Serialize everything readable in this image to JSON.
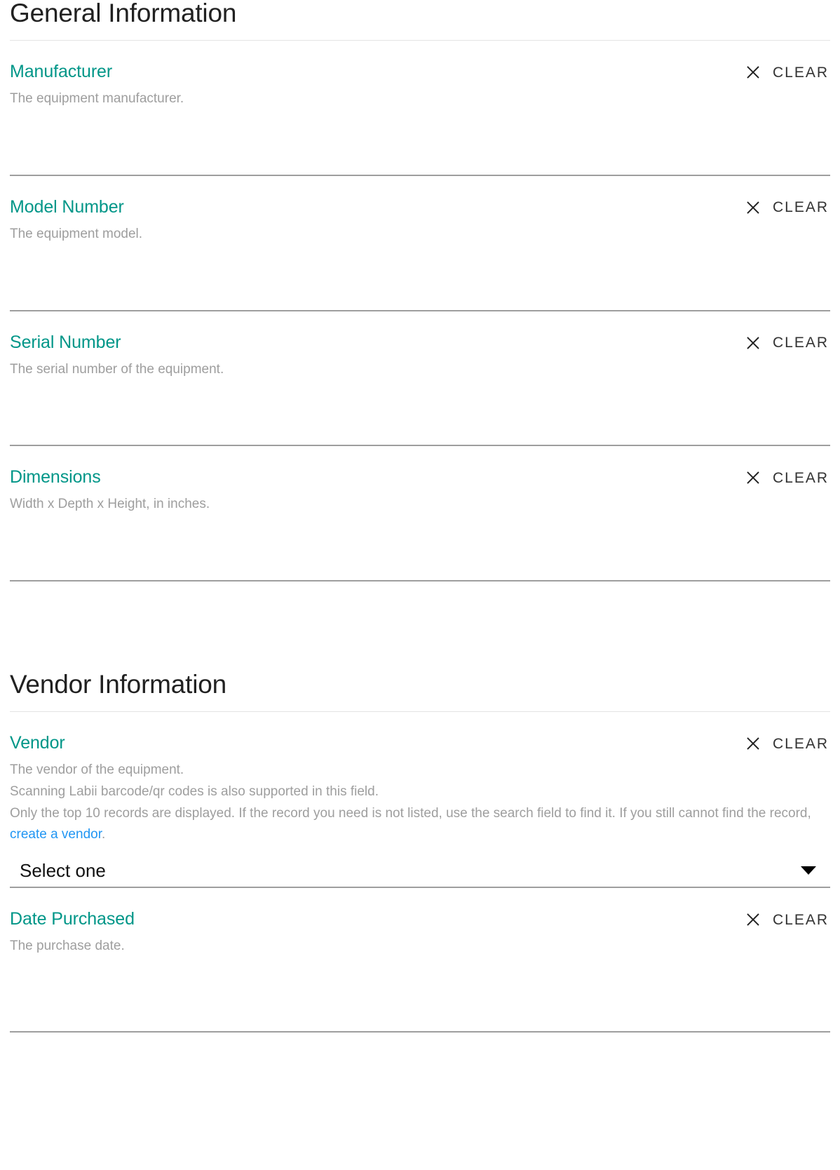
{
  "sections": [
    {
      "title": "General Information",
      "fields": [
        {
          "label": "Manufacturer",
          "desc_lines": [
            "The equipment manufacturer."
          ],
          "clear_label": "CLEAR",
          "clear_icon": "close-icon"
        },
        {
          "label": "Model Number",
          "desc_lines": [
            "The equipment model."
          ],
          "clear_label": "CLEAR",
          "clear_icon": "close-icon"
        },
        {
          "label": "Serial Number",
          "desc_lines": [
            "The serial number of the equipment."
          ],
          "clear_label": "CLEAR",
          "clear_icon": "close-icon"
        },
        {
          "label": "Dimensions",
          "desc_lines": [
            "Width x Depth x Height, in inches."
          ],
          "clear_label": "CLEAR",
          "clear_icon": "close-icon"
        }
      ]
    },
    {
      "title": "Vendor Information",
      "fields": [
        {
          "label": "Vendor",
          "desc_lines": [
            "The vendor of the equipment.",
            "Scanning Labii barcode/qr codes is also supported in this field."
          ],
          "desc_rich_prefix": "Only the top 10 records are displayed. If the record you need is not listed, use the search field to find it. If you still cannot find the record, ",
          "desc_link_text": "create a vendor",
          "desc_rich_suffix": ".",
          "clear_label": "CLEAR",
          "clear_icon": "close-icon",
          "select_value": "Select one",
          "select_caret": "chevron-down-icon"
        },
        {
          "label": "Date Purchased",
          "desc_lines": [
            "The purchase date."
          ],
          "clear_label": "CLEAR",
          "clear_icon": "close-icon"
        }
      ]
    }
  ],
  "colors": {
    "label_teal": "#009688",
    "link_blue": "#2196f3",
    "desc_gray": "#9e9e9e",
    "divider_gray": "#9e9e9e",
    "heading_rule": "#e4e4e4",
    "heading_text": "#212121"
  }
}
